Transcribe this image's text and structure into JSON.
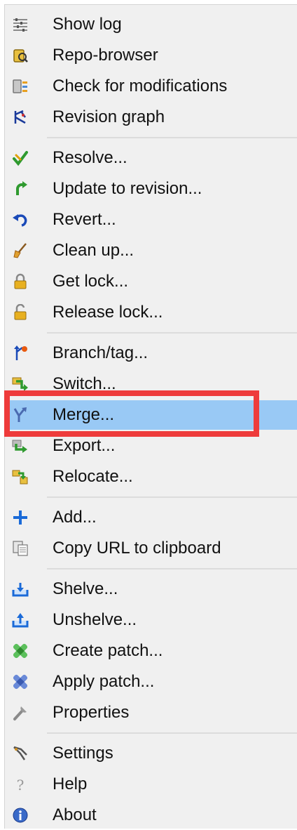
{
  "menu": {
    "items": [
      {
        "label": "Show log",
        "icon": "show-log-icon"
      },
      {
        "label": "Repo-browser",
        "icon": "repo-browser-icon"
      },
      {
        "label": "Check for modifications",
        "icon": "check-modifications-icon"
      },
      {
        "label": "Revision graph",
        "icon": "revision-graph-icon"
      },
      {
        "label": "Resolve...",
        "icon": "resolve-icon"
      },
      {
        "label": "Update to revision...",
        "icon": "update-icon"
      },
      {
        "label": "Revert...",
        "icon": "revert-icon"
      },
      {
        "label": "Clean up...",
        "icon": "cleanup-icon"
      },
      {
        "label": "Get lock...",
        "icon": "lock-icon"
      },
      {
        "label": "Release lock...",
        "icon": "unlock-icon"
      },
      {
        "label": "Branch/tag...",
        "icon": "branch-icon"
      },
      {
        "label": "Switch...",
        "icon": "switch-icon"
      },
      {
        "label": "Merge...",
        "icon": "merge-icon",
        "selected": true
      },
      {
        "label": "Export...",
        "icon": "export-icon"
      },
      {
        "label": "Relocate...",
        "icon": "relocate-icon"
      },
      {
        "label": "Add...",
        "icon": "add-icon"
      },
      {
        "label": "Copy URL to clipboard",
        "icon": "copy-url-icon"
      },
      {
        "label": "Shelve...",
        "icon": "shelve-icon"
      },
      {
        "label": "Unshelve...",
        "icon": "unshelve-icon"
      },
      {
        "label": "Create patch...",
        "icon": "create-patch-icon"
      },
      {
        "label": "Apply patch...",
        "icon": "apply-patch-icon"
      },
      {
        "label": "Properties",
        "icon": "properties-icon"
      },
      {
        "label": "Settings",
        "icon": "settings-icon"
      },
      {
        "label": "Help",
        "icon": "help-icon"
      },
      {
        "label": "About",
        "icon": "about-icon"
      }
    ]
  },
  "colors": {
    "menu_background": "#f0f0f0",
    "selected_background": "#99c9f5",
    "annotation_box": "#ee3b3b"
  }
}
